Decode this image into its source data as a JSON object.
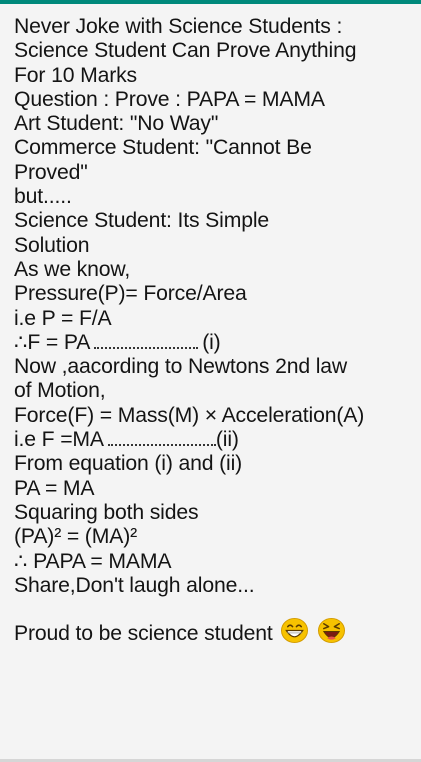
{
  "lines": [
    "Never Joke with Science Students :",
    "Science Student Can Prove Anything",
    "For 10 Marks",
    "Question : Prove : PAPA = MAMA",
    "Art Student: \"No Way\"",
    "Commerce Student: \"Cannot Be",
    "Proved\"",
    "but.....",
    "Science Student: Its Simple",
    "Solution",
    "As we know,",
    "Pressure(P)= Force/Area",
    "i.e P = F/A",
    {
      "pre": "∴F = PA",
      "post": "(i)"
    },
    "Now ,aacording to Newtons 2nd law",
    "of Motion,",
    "Force(F) = Mass(M) × Acceleration(A)",
    {
      "pre": "i.e F =MA",
      "post": "(ii)"
    },
    "From equation (i) and (ii)",
    "PA = MA",
    "Squaring both sides",
    "(PA)² = (MA)²",
    "∴ PAPA = MAMA",
    "Share,Don't laugh alone..."
  ],
  "footer": "Proud to be science student",
  "emojis": [
    "grinning-face-icon",
    "laughing-face-icon"
  ],
  "colors": {
    "accent": "#00897b",
    "text": "#141414",
    "emoji_yellow": "#f7c200"
  }
}
